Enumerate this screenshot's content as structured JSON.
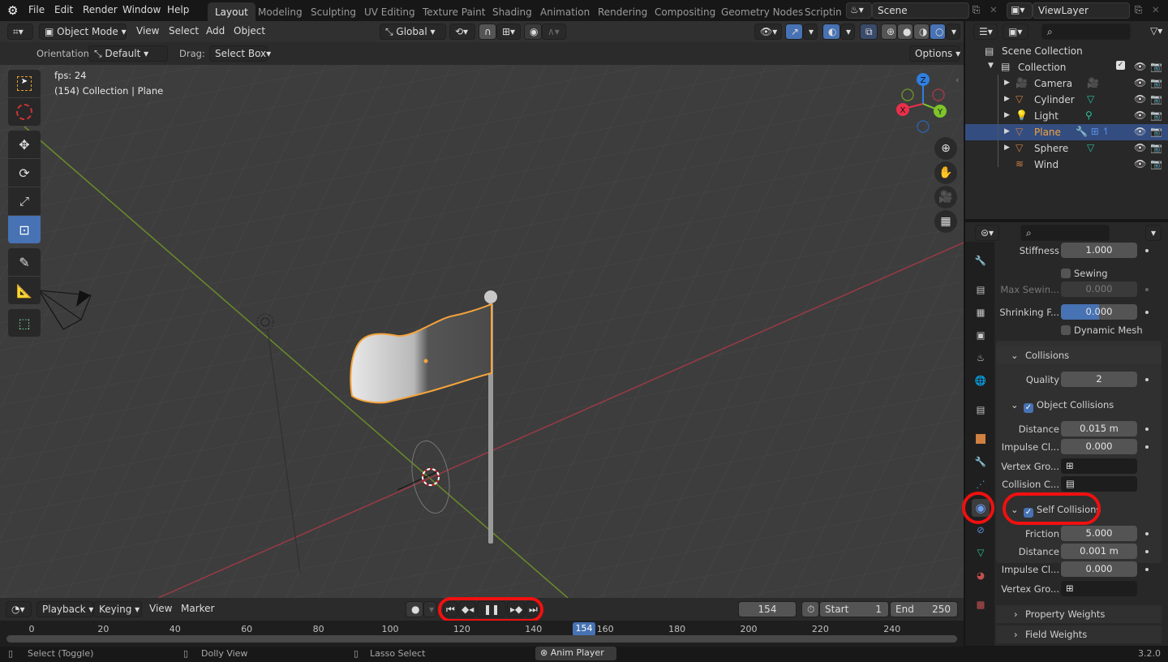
{
  "app": {
    "name": "Blender",
    "version": "3.2.0"
  },
  "menubar": {
    "items": [
      "File",
      "Edit",
      "Render",
      "Window",
      "Help"
    ],
    "workspaces": [
      "Layout",
      "Modeling",
      "Sculpting",
      "UV Editing",
      "Texture Paint",
      "Shading",
      "Animation",
      "Rendering",
      "Compositing",
      "Geometry Nodes",
      "Scripting"
    ],
    "active_workspace": "Layout",
    "scene": "Scene",
    "view_layer": "ViewLayer"
  },
  "viewport_header": {
    "mode": "Object Mode",
    "menus": [
      "View",
      "Select",
      "Add",
      "Object"
    ],
    "transform_orientation": "Global",
    "options_label": "Options"
  },
  "tool_header": {
    "orientation_label": "Orientation:",
    "orientation_value": "Default",
    "drag_label": "Drag:",
    "drag_value": "Select Box"
  },
  "viewport": {
    "overlay_line1": "fps: 24",
    "overlay_line2": "(154) Collection | Plane",
    "gizmo_axes": {
      "x": "X",
      "y": "Y",
      "z": "Z"
    },
    "colors": {
      "x": "#e8304b",
      "y": "#7fc52a",
      "z": "#2f7ee0",
      "selection": "#f5a33b",
      "active_tool": "#4772b3"
    }
  },
  "toolbar": {
    "tools": [
      "select-box",
      "cursor",
      "move",
      "rotate",
      "scale",
      "transform",
      "annotate",
      "measure",
      "add-cube"
    ],
    "active_tool": "transform"
  },
  "outliner": {
    "root": "Scene Collection",
    "collection": "Collection",
    "items": [
      {
        "name": "Camera",
        "type": "camera",
        "selected": false
      },
      {
        "name": "Cylinder",
        "type": "mesh",
        "selected": false
      },
      {
        "name": "Light",
        "type": "light",
        "selected": false
      },
      {
        "name": "Plane",
        "type": "mesh",
        "selected": true
      },
      {
        "name": "Sphere",
        "type": "mesh",
        "selected": false
      },
      {
        "name": "Wind",
        "type": "force",
        "selected": false
      }
    ]
  },
  "properties": {
    "rows": {
      "stiffness": {
        "label": "Stiffness",
        "value": "1.000"
      },
      "sewing": {
        "label": "Sewing",
        "checked": false
      },
      "max_sewing": {
        "label": "Max Sewin...",
        "value": "0.000"
      },
      "shrinking": {
        "label": "Shrinking F...",
        "value": "0.000",
        "fill": 0.5
      },
      "dynamic_mesh": {
        "label": "Dynamic Mesh",
        "checked": false
      },
      "collisions": {
        "label": "Collisions"
      },
      "quality": {
        "label": "Quality",
        "value": "2"
      },
      "object_collisions": {
        "label": "Object Collisions",
        "checked": true
      },
      "oc_distance": {
        "label": "Distance",
        "value": "0.015 m"
      },
      "oc_impulse": {
        "label": "Impulse Cl...",
        "value": "0.000"
      },
      "oc_vgroup": {
        "label": "Vertex Gro..."
      },
      "oc_collection": {
        "label": "Collision C..."
      },
      "self_collisions": {
        "label": "Self Collisions",
        "checked": true
      },
      "sc_friction": {
        "label": "Friction",
        "value": "5.000"
      },
      "sc_distance": {
        "label": "Distance",
        "value": "0.001 m"
      },
      "sc_impulse": {
        "label": "Impulse Cl...",
        "value": "0.000"
      },
      "sc_vgroup": {
        "label": "Vertex Gro..."
      },
      "property_weights": {
        "label": "Property Weights"
      },
      "field_weights": {
        "label": "Field Weights"
      }
    },
    "active_tab": "physics"
  },
  "timeline": {
    "menus": [
      "Playback",
      "Keying",
      "View",
      "Marker"
    ],
    "current_frame": "154",
    "start_label": "Start",
    "start": "1",
    "end_label": "End",
    "end": "250",
    "ticks": [
      "0",
      "20",
      "40",
      "60",
      "80",
      "100",
      "120",
      "140",
      "160",
      "180",
      "200",
      "220",
      "240"
    ]
  },
  "statusbar": {
    "hints": [
      "Select (Toggle)",
      "Dolly View",
      "Lasso Select"
    ],
    "running_job": "Anim Player",
    "version": "3.2.0"
  }
}
